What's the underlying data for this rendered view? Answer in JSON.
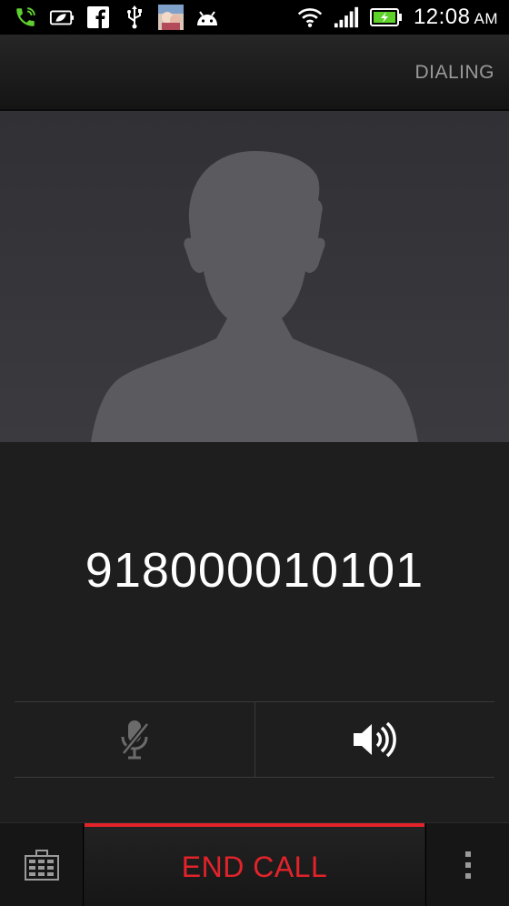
{
  "status_bar": {
    "notification_icons": [
      "phone-call-icon",
      "leaf-battery-icon",
      "facebook-icon",
      "usb-icon",
      "app-thumbnail-icon",
      "android-icon"
    ],
    "system_icons": [
      "wifi-icon",
      "signal-icon",
      "battery-charging-icon"
    ],
    "time": "12:08",
    "ampm": "AM"
  },
  "call": {
    "state": "DIALING",
    "number": "918000010101"
  },
  "controls": {
    "mute_icon": "mic-muted-icon",
    "speaker_icon": "speaker-icon"
  },
  "bottom_bar": {
    "end_call_label": "END CALL",
    "end_call_color": "#e2232a",
    "dialpad_icon": "dialpad-icon",
    "menu_icon": "overflow-menu-icon"
  },
  "colors": {
    "phone_green": "#5fcf2f",
    "battery_green": "#5ed12a"
  }
}
